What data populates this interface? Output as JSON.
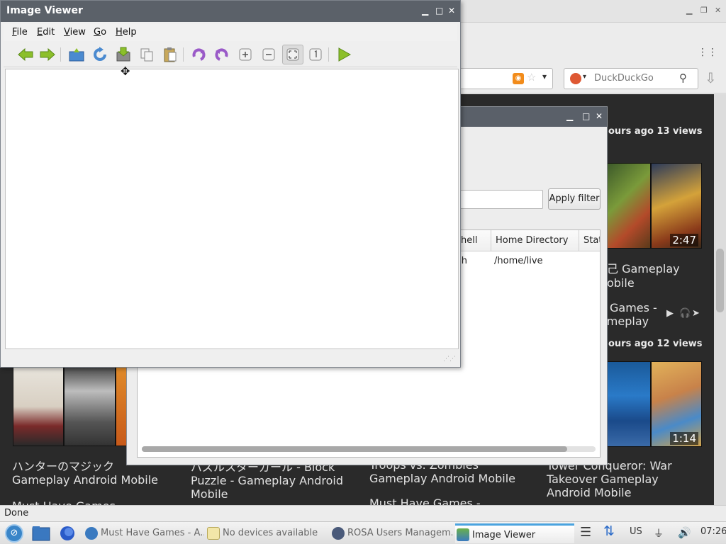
{
  "browser": {
    "search_placeholder": "DuckDuckGo",
    "status": "Done",
    "videos": [
      {
        "meta": "ours ago  13 views",
        "duration": "2:47",
        "title_lines": [
          "己 Gameplay",
          "obile"
        ]
      },
      {
        "meta": "",
        "duration": "",
        "title_lines": [
          "Games -",
          "ameplay"
        ]
      },
      {
        "meta": "ours ago  12 views",
        "duration": "1:14",
        "title_lines": []
      }
    ],
    "bottom_titles": [
      "ハンターのマジック Gameplay Android Mobile",
      "パズルスターガール - Block Puzzle - Gameplay Android Mobile",
      "Troops vs. Zombies Gameplay Android Mobile",
      "Tower Conqueror: War Takeover Gameplay Android Mobile"
    ],
    "partial_title": "Must Have Games -",
    "partial_title_2": "Must Have Games -"
  },
  "rosa": {
    "apply_filter": "Apply filter",
    "columns": [
      "hell",
      "Home Directory",
      "Stat"
    ],
    "row": {
      "shell": "sh",
      "home": "/home/live"
    }
  },
  "image_viewer": {
    "title": "Image Viewer",
    "menu": [
      "File",
      "Edit",
      "View",
      "Go",
      "Help"
    ]
  },
  "taskbar": {
    "tasks": [
      {
        "label": "Must Have Games - A...",
        "active": false
      },
      {
        "label": "No devices available",
        "active": false
      },
      {
        "label": "ROSA Users Managem...",
        "active": false
      },
      {
        "label": "Image Viewer",
        "active": true
      }
    ],
    "keyboard_layout": "US",
    "clock": "07:26"
  },
  "colors": {
    "titlebar": "#5b6169",
    "accent": "#4aa3df",
    "page_bg": "#2a2a2a"
  }
}
